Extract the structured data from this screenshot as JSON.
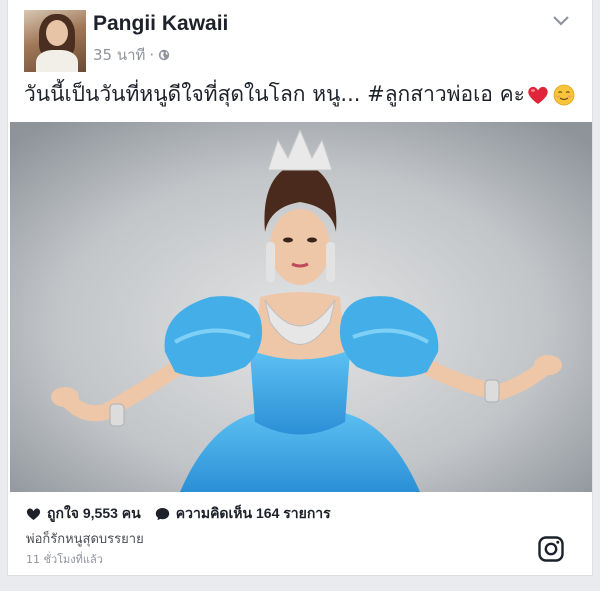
{
  "post": {
    "author": "Pangii Kawaii",
    "time": "35 นาที",
    "dot": "·",
    "text": "วันนี้เป็นวันที่หนูดีใจที่สุดในโลก หนู... #ลูกสาวพ่อเอ คะ",
    "emojis": [
      "heart-emoji",
      "relieved-face-emoji"
    ]
  },
  "embed": {
    "likes": "ถูกใจ 9,553 คน",
    "comments": "ความคิดเห็น 164 รายการ",
    "caption": "พ่อก็รักหนูสุดบรรยาย",
    "timestamp": "11 ชั่วโมงที่แล้ว",
    "source_icon": "instagram-icon"
  },
  "colors": {
    "dress": "#3aa3e0",
    "heart": "#e0243a",
    "text": "#1d2129",
    "muted": "#90949c"
  }
}
